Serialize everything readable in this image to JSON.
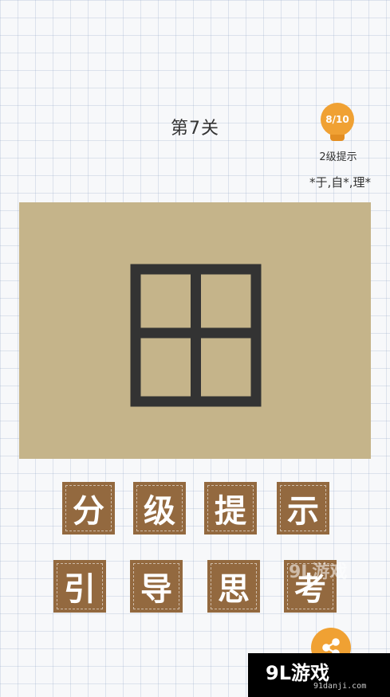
{
  "level": {
    "title": "第7关"
  },
  "hint": {
    "counter": "8/10",
    "level_label": "2级提示",
    "text": "*于,自*,理*"
  },
  "puzzle": {
    "glyph_icon": "田-shaped-grid-character",
    "frame_color": "#c5b48a",
    "stroke_color": "#333333"
  },
  "tiles": [
    "分",
    "级",
    "提",
    "示",
    "引",
    "导",
    "思",
    "考"
  ],
  "colors": {
    "tile": "#93693f",
    "accent": "#f0a133"
  },
  "share": {
    "icon": "share-icon"
  },
  "watermark": {
    "logo": "9L游戏",
    "url": "91danji.com",
    "overlay": "9L游戏"
  }
}
